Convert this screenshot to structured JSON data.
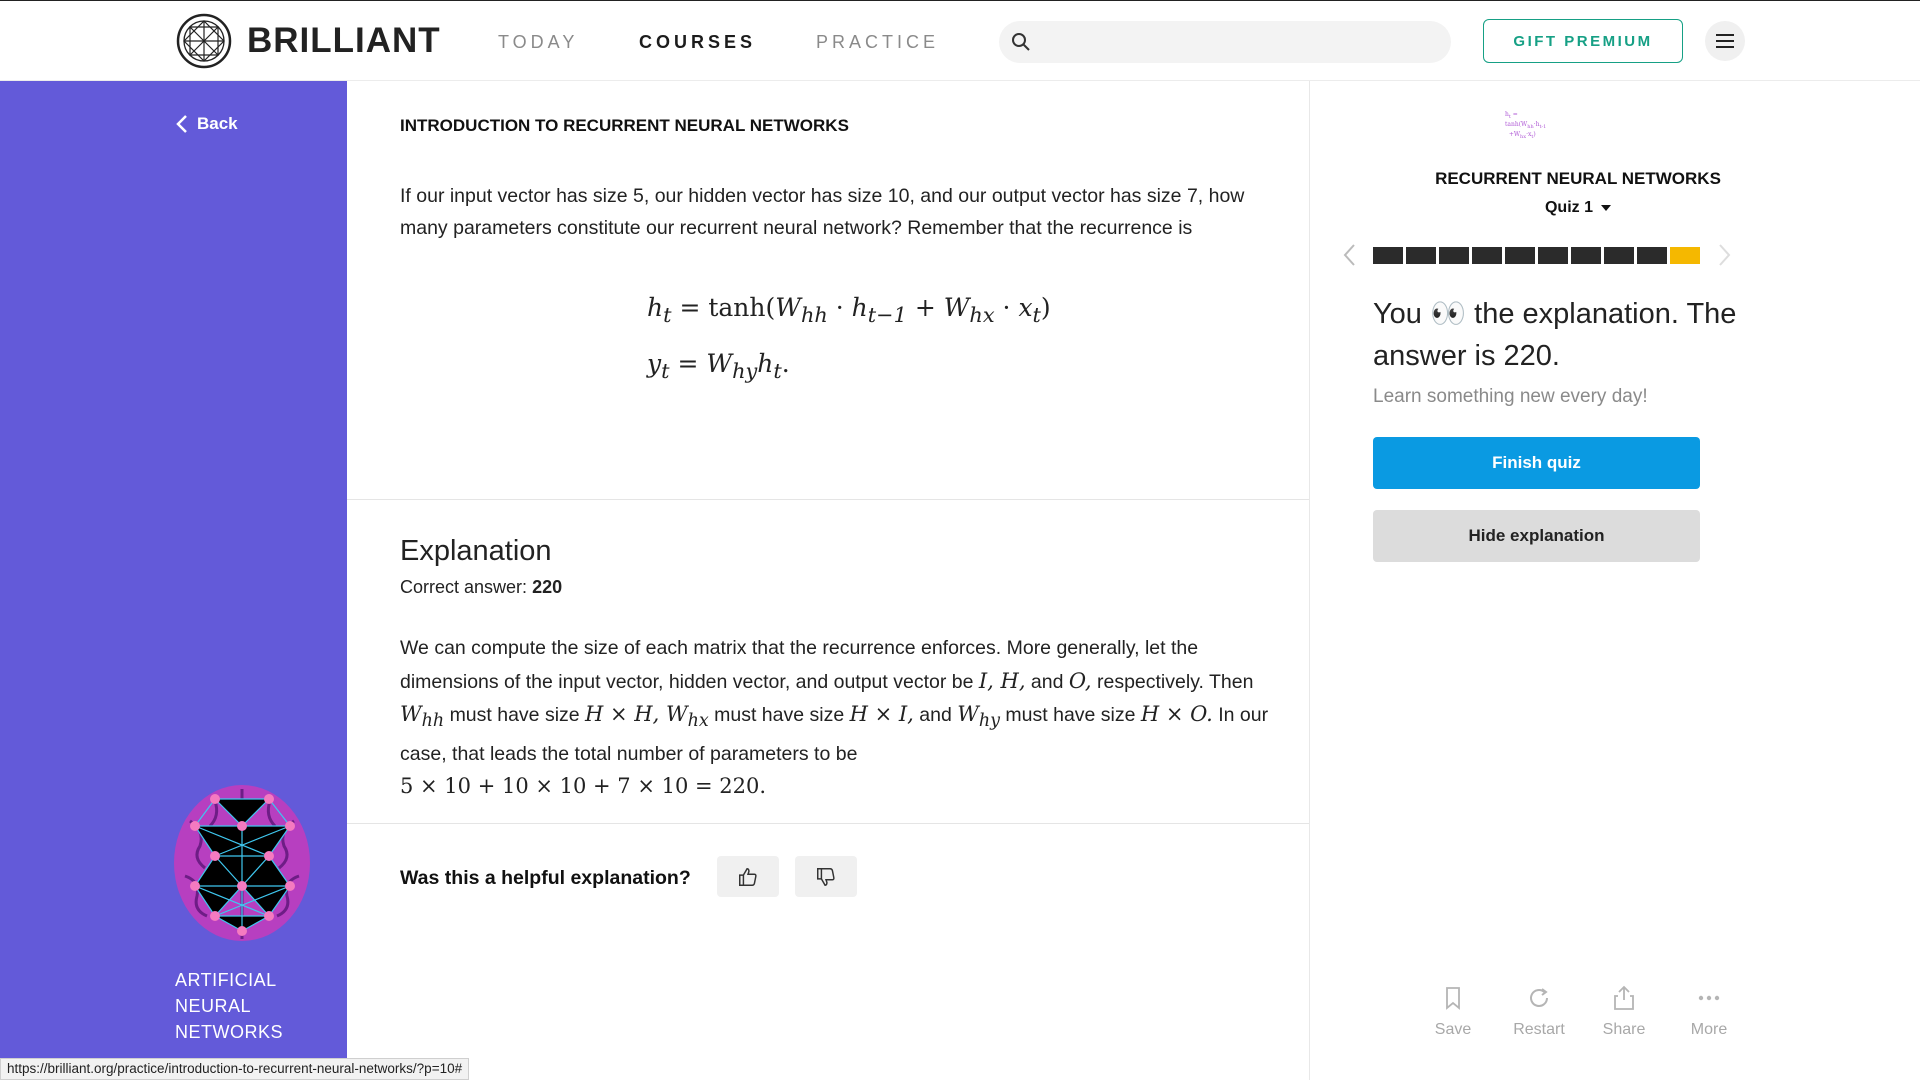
{
  "header": {
    "logo_text": "BRILLIANT",
    "nav": [
      "TODAY",
      "COURSES",
      "PRACTICE"
    ],
    "active_nav": "COURSES",
    "search_placeholder": "",
    "gift_label": "GIFT PREMIUM",
    "accent_color": "#16a085"
  },
  "sidebar": {
    "back_label": "Back",
    "course_name": "ARTIFICIAL NEURAL NETWORKS",
    "background_color": "#635ad9"
  },
  "main": {
    "title": "INTRODUCTION TO RECURRENT NEURAL NETWORKS",
    "question": "If our input vector has size 5, our hidden vector has size 10, and our output vector has size 7, how many parameters constitute our recurrent neural network? Remember that the recurrence is",
    "explanation_title": "Explanation",
    "correct_label": "Correct answer:",
    "correct_value": "220",
    "explanation_part1": "We can compute the size of each matrix that the recurrence enforces. More generally, let the dimensions of the input vector, hidden vector, and output vector be",
    "explanation_part2": "respectively. Then",
    "explanation_part3": "must have size",
    "explanation_part4": "must have size",
    "explanation_part5": "and",
    "explanation_part6": "must have size",
    "explanation_part7": "In our case, that leads the total number of parameters to be",
    "helpful_question": "Was this a helpful explanation?"
  },
  "right": {
    "section_title": "RECURRENT NEURAL NETWORKS",
    "quiz_label": "Quiz 1",
    "progress_total": 10,
    "progress_current": 10,
    "headline": "You 👀 the explanation. The answer is 220.",
    "subtext": "Learn something new every day!",
    "finish_label": "Finish quiz",
    "hide_label": "Hide explanation",
    "primary_color": "#0a9ae2",
    "highlight_color": "#f5b800",
    "actions": [
      "Save",
      "Restart",
      "Share",
      "More"
    ]
  },
  "status_url": "https://brilliant.org/practice/introduction-to-recurrent-neural-networks/?p=10#"
}
